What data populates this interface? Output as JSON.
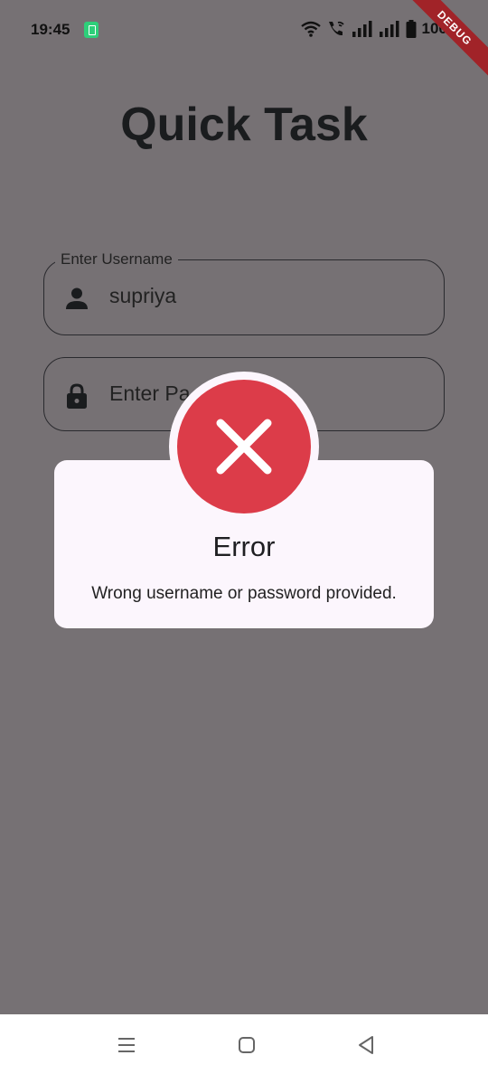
{
  "status_bar": {
    "time": "19:45",
    "battery": "100%",
    "icons": [
      "app-notification-icon",
      "wifi-icon",
      "wifi-calling-icon",
      "signal-icon",
      "signal-icon",
      "battery-icon"
    ]
  },
  "debug_banner": "DEBUG",
  "app": {
    "title": "Quick Task"
  },
  "form": {
    "username": {
      "label": "Enter Username",
      "value": "supriya",
      "icon": "person-icon"
    },
    "password": {
      "placeholder": "Enter Pa",
      "icon": "lock-icon"
    }
  },
  "dialog": {
    "icon": "error-x-icon",
    "title": "Error",
    "message": "Wrong username or password provided."
  },
  "nav_bar": {
    "icons": [
      "menu-icon",
      "home-icon",
      "back-icon"
    ]
  },
  "colors": {
    "scrim_background": "#767174",
    "dialog_background": "#fcf6fd",
    "error_red": "#dc3c49",
    "debug_banner": "#a12328"
  }
}
